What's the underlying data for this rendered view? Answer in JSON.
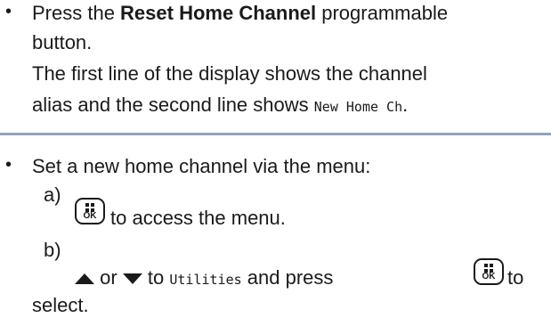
{
  "reset": {
    "bullet": "•",
    "line1_pre": "Press the ",
    "button_name": "Reset Home Channel",
    "line1_post": " programmable",
    "line2": "button.",
    "line3": "The first line of the display shows the channel",
    "line4_pre": "alias and the second line shows ",
    "display_text": "New Home Ch",
    "line4_post": "."
  },
  "menu": {
    "bullet": "•",
    "intro": "Set a new home channel via the menu:",
    "step_a_label": "a)",
    "step_a_text": "to access the menu.",
    "step_b_label": "b)",
    "or_text": " or ",
    "to_text": " to ",
    "utilities": "Utilities",
    "and_press": " and press ",
    "to_end": " to",
    "select_text": "select."
  },
  "icons": {
    "ok_key": "menu-ok-key-icon",
    "ok_label": "OK",
    "up": "up-arrow-icon",
    "down": "down-arrow-icon"
  },
  "colors": {
    "divider": "#8ea3bd"
  }
}
